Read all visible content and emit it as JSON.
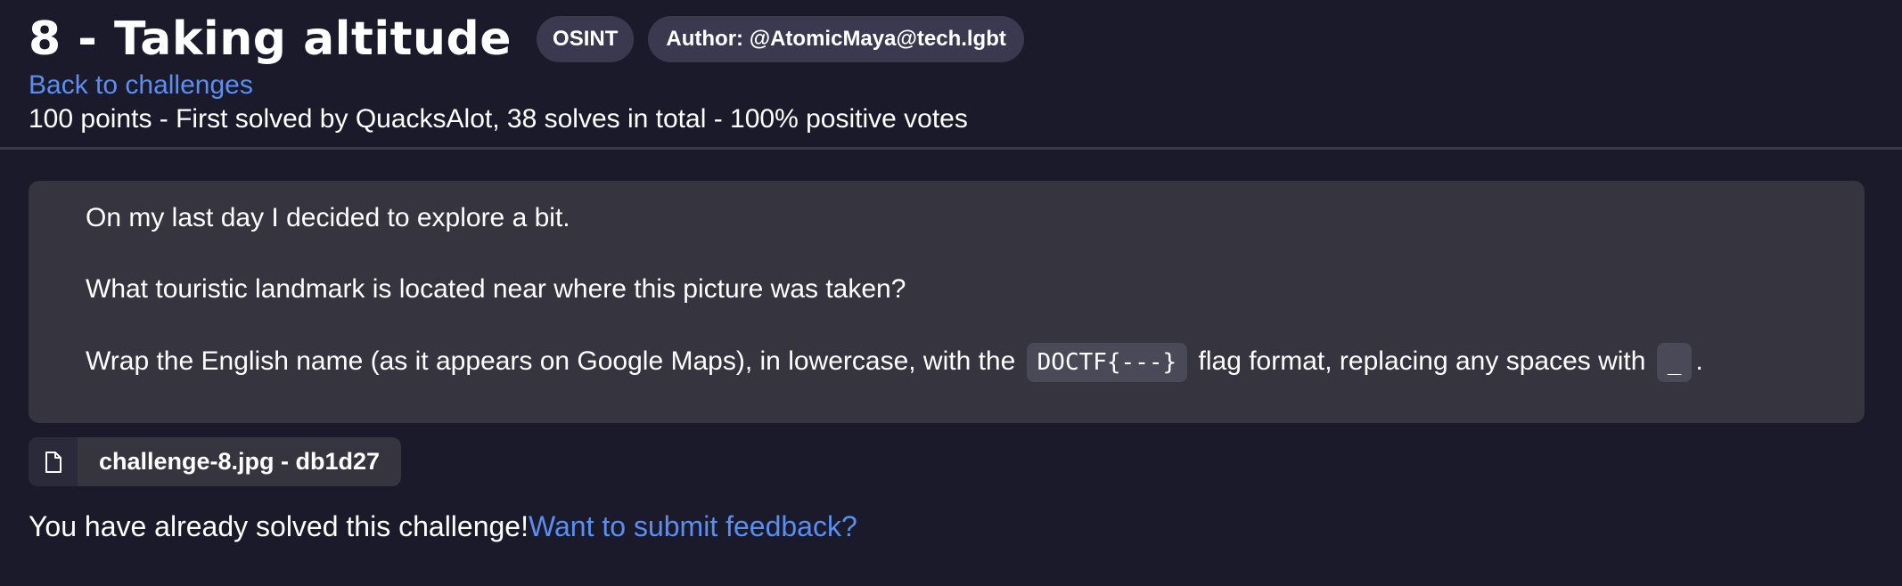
{
  "header": {
    "title": "8 - Taking altitude",
    "category_tag": "OSINT",
    "author_tag": "Author: @AtomicMaya@tech.lgbt",
    "back_link": "Back to challenges",
    "meta": "100 points - First solved by QuacksAlot, 38 solves in total - 100% positive votes"
  },
  "description": {
    "line1": "On my last day I decided to explore a bit.",
    "line2": "What touristic landmark is located near where this picture was taken?",
    "line3_before": "Wrap the English name (as it appears on Google Maps), in lowercase, with the ",
    "line3_code1": "DOCTF{---}",
    "line3_middle": " flag format, replacing any spaces with ",
    "line3_code2": "_",
    "line3_after": "."
  },
  "attachment": {
    "icon": "file-icon",
    "label": "challenge-8.jpg - db1d27"
  },
  "status": {
    "solved_text": "You have already solved this challenge!",
    "feedback_link": "Want to submit feedback?"
  },
  "colors": {
    "background": "#1b1a2b",
    "panel": "#35343f",
    "tag": "#3a3950",
    "link": "#5b8ef0"
  }
}
